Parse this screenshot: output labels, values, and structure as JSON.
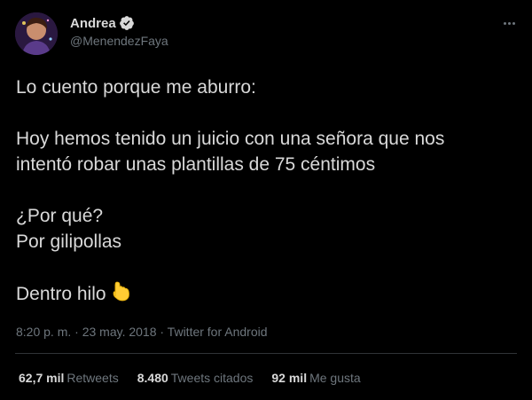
{
  "author": {
    "name": "Andrea",
    "handle": "@MenendezFaya",
    "verified": true
  },
  "icons": {
    "avatar": "profile-avatar",
    "verified": "verified-badge-icon",
    "more": "more-options-icon",
    "emoji": "backhand-index-pointing-down-emoji"
  },
  "tweet": {
    "line1": "Lo cuento porque me aburro:",
    "line2": "Hoy hemos tenido un juicio con una señora que nos",
    "line3": "intentó robar unas plantillas de 75 céntimos",
    "line4": "¿Por qué?",
    "line5": "Por gilipollas",
    "line6": "Dentro hilo"
  },
  "meta": {
    "timestamp_source": "8:20 p. m. · 23 may. 2018 · Twitter for Android"
  },
  "stats": {
    "retweets_count": "62,7 mil",
    "retweets_label": "Retweets",
    "quotes_count": "8.480",
    "quotes_label": "Tweets citados",
    "likes_count": "92 mil",
    "likes_label": "Me gusta"
  },
  "colors": {
    "background": "#000000",
    "text": "#d9d9d9",
    "secondary": "#6e767d",
    "divider": "#2f3336"
  }
}
